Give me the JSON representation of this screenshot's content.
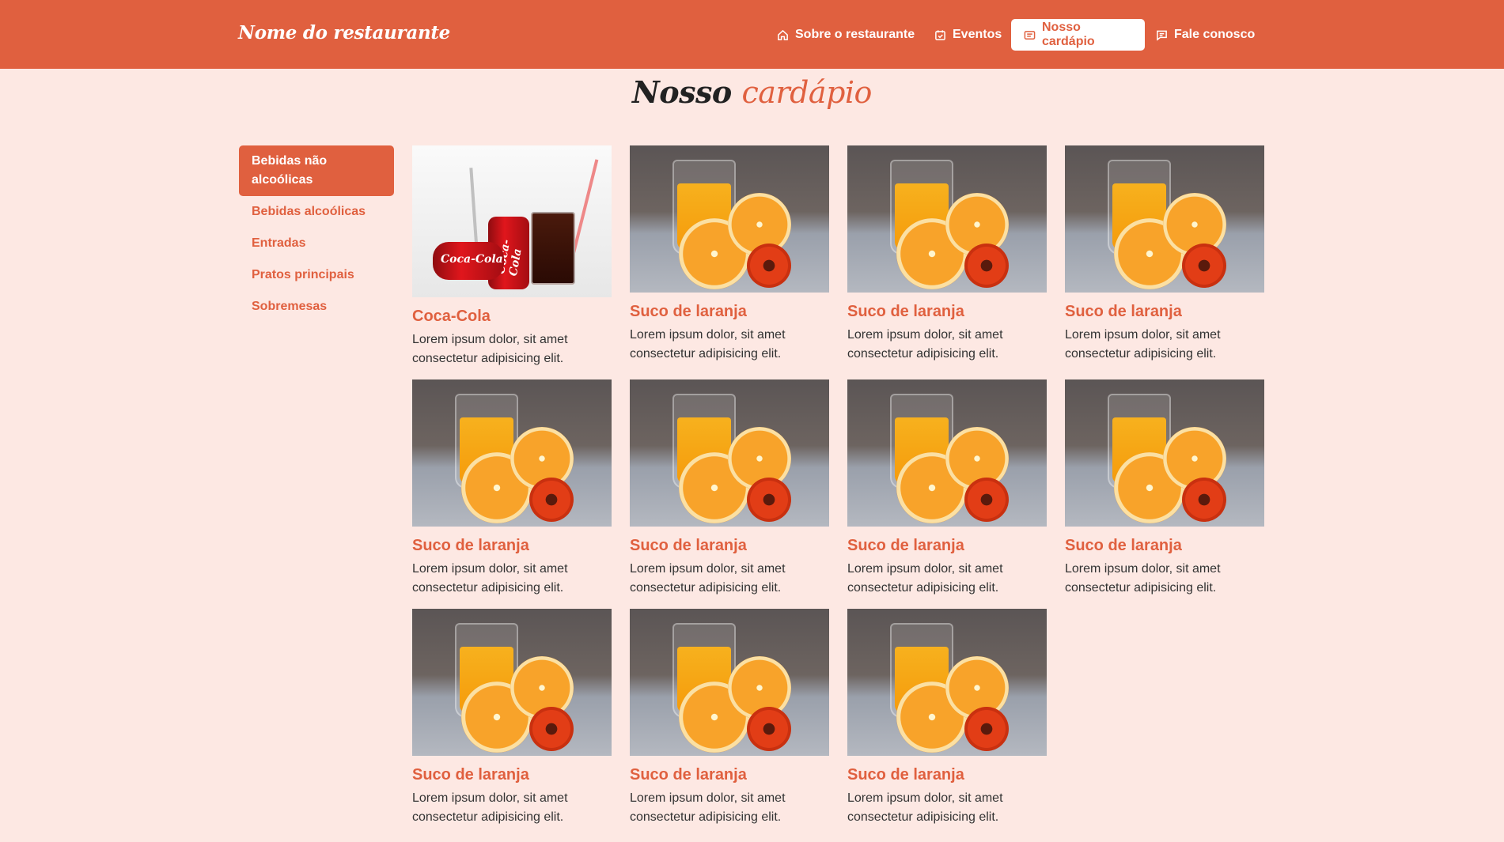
{
  "brand": "Nome do restaurante",
  "nav": [
    {
      "label": "Sobre o restaurante",
      "icon": "home-icon"
    },
    {
      "label": "Eventos",
      "icon": "calendar-check-icon"
    },
    {
      "label": "Nosso cardápio",
      "icon": "menu-list-icon",
      "active": true
    },
    {
      "label": "Fale conosco",
      "icon": "chat-icon"
    }
  ],
  "title": {
    "part1": "Nosso",
    "part2": "cardápio"
  },
  "sidebar": {
    "items": [
      {
        "label": "Bebidas não alcoólicas",
        "active": true
      },
      {
        "label": "Bebidas alcoólicas"
      },
      {
        "label": "Entradas"
      },
      {
        "label": "Pratos principais"
      },
      {
        "label": "Sobremesas"
      }
    ]
  },
  "menu_items": [
    {
      "name": "Coca-Cola",
      "desc": "Lorem ipsum dolor, sit amet consectetur adipisicing elit.",
      "image": "coca-cola"
    },
    {
      "name": "Suco de laranja",
      "desc": "Lorem ipsum dolor, sit amet consectetur adipisicing elit.",
      "image": "orange-juice"
    },
    {
      "name": "Suco de laranja",
      "desc": "Lorem ipsum dolor, sit amet consectetur adipisicing elit.",
      "image": "orange-juice"
    },
    {
      "name": "Suco de laranja",
      "desc": "Lorem ipsum dolor, sit amet consectetur adipisicing elit.",
      "image": "orange-juice"
    },
    {
      "name": "Suco de laranja",
      "desc": "Lorem ipsum dolor, sit amet consectetur adipisicing elit.",
      "image": "orange-juice"
    },
    {
      "name": "Suco de laranja",
      "desc": "Lorem ipsum dolor, sit amet consectetur adipisicing elit.",
      "image": "orange-juice"
    },
    {
      "name": "Suco de laranja",
      "desc": "Lorem ipsum dolor, sit amet consectetur adipisicing elit.",
      "image": "orange-juice"
    },
    {
      "name": "Suco de laranja",
      "desc": "Lorem ipsum dolor, sit amet consectetur adipisicing elit.",
      "image": "orange-juice"
    },
    {
      "name": "Suco de laranja",
      "desc": "Lorem ipsum dolor, sit amet consectetur adipisicing elit.",
      "image": "orange-juice"
    },
    {
      "name": "Suco de laranja",
      "desc": "Lorem ipsum dolor, sit amet consectetur adipisicing elit.",
      "image": "orange-juice"
    },
    {
      "name": "Suco de laranja",
      "desc": "Lorem ipsum dolor, sit amet consectetur adipisicing elit.",
      "image": "orange-juice"
    }
  ],
  "colors": {
    "accent": "#e0603f",
    "background": "#fde8e3",
    "header": "#e0603f"
  }
}
